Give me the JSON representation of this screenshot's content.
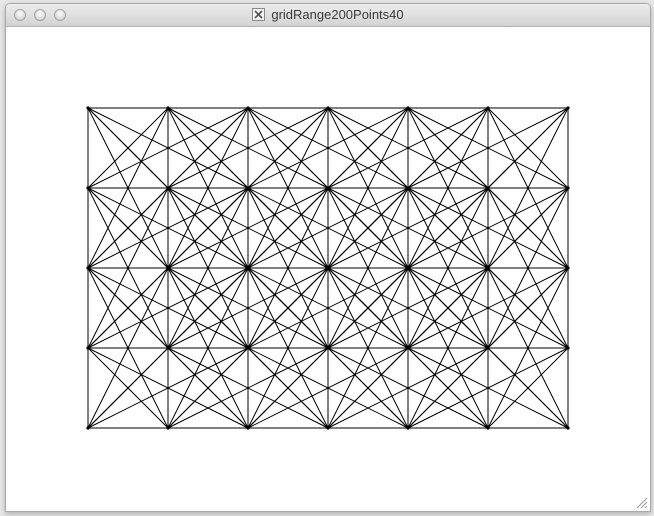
{
  "window": {
    "title": "gridRange200Points40",
    "title_icon": "x11-app-icon"
  },
  "traffic_lights": [
    "close",
    "minimize",
    "zoom"
  ],
  "canvas": {
    "background": "#ffffff",
    "stroke_color": "#000000",
    "grid_columns": 7,
    "grid_rows": 5,
    "connect_range_cells": 2
  }
}
